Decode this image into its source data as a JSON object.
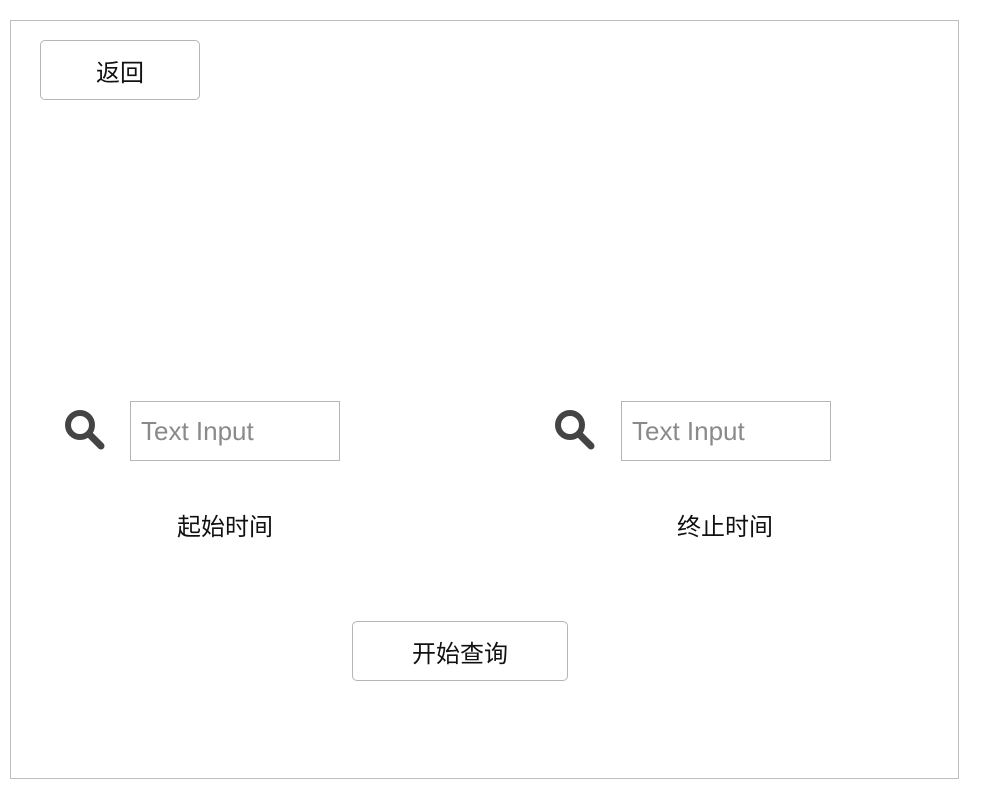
{
  "toolbar": {
    "back_label": "返回"
  },
  "start_field": {
    "placeholder": "Text Input",
    "value": "",
    "label": "起始时间",
    "icon": "search-icon"
  },
  "end_field": {
    "placeholder": "Text Input",
    "value": "",
    "label": "终止时间",
    "icon": "search-icon"
  },
  "actions": {
    "query_label": "开始查询"
  },
  "colors": {
    "border": "#b5b5b5",
    "icon": "#444444",
    "text": "#111111",
    "placeholder": "#8a8a8a"
  }
}
